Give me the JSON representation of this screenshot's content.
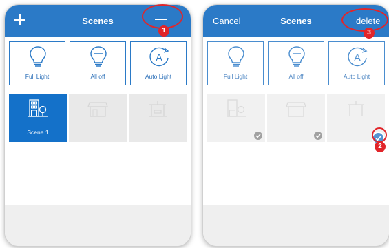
{
  "colors": {
    "header_blue": "#2b7ac7",
    "selected_tile_blue": "#1471c9",
    "callout_red": "#e1252a",
    "check_gray": "#8a8a8a"
  },
  "left_screen": {
    "title": "Scenes",
    "add_icon": "plus-icon",
    "remove_icon": "minus-icon",
    "callout_number": "1",
    "quick_tiles": [
      {
        "label": "Full Light",
        "icon": "light-bulb-icon"
      },
      {
        "label": "All off",
        "icon": "light-bulb-off-icon"
      },
      {
        "label": "Auto Light",
        "icon": "auto-light-icon"
      }
    ],
    "scenes": [
      {
        "label": "Scene 1",
        "icon": "building-tree-icon",
        "state": "selected"
      },
      {
        "label": "",
        "icon": "shop-awning-icon",
        "state": "blurred"
      },
      {
        "label": "",
        "icon": "pergola-icon",
        "state": "blurred"
      }
    ]
  },
  "right_screen": {
    "cancel_label": "Cancel",
    "title": "Scenes",
    "delete_label": "delete",
    "callout_delete_number": "3",
    "callout_check_number": "2",
    "quick_tiles": [
      {
        "label": "Full Light",
        "icon": "light-bulb-icon"
      },
      {
        "label": "All off",
        "icon": "light-bulb-off-icon"
      },
      {
        "label": "Auto Light",
        "icon": "auto-light-icon"
      }
    ],
    "scenes": [
      {
        "icon": "building-tree-icon",
        "checked": false
      },
      {
        "icon": "shop-awning-icon",
        "checked": false
      },
      {
        "icon": "pergola-icon",
        "checked": true
      }
    ]
  }
}
